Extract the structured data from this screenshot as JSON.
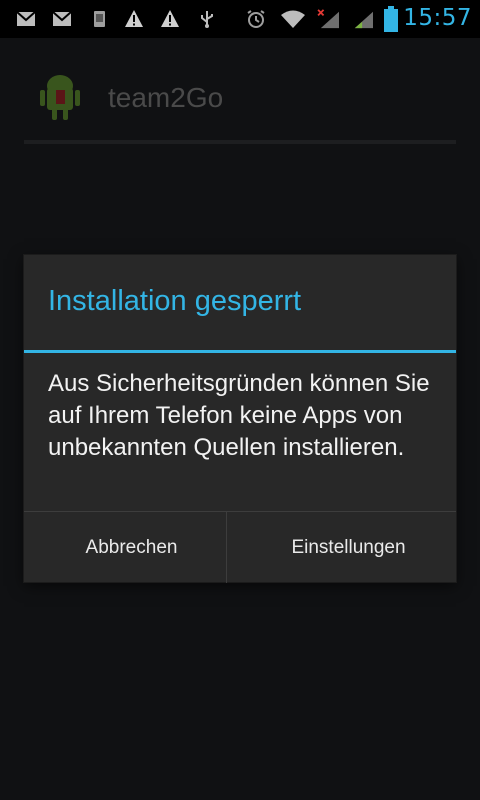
{
  "status_bar": {
    "time": "15:57",
    "accent_color": "#33b5e5",
    "icons": [
      "gmail-icon",
      "gmail-icon",
      "phone-storage-icon",
      "warning-icon",
      "warning-icon",
      "usb-icon",
      "alarm-icon",
      "wifi-icon",
      "signal-no-data-icon",
      "signal-icon",
      "battery-icon"
    ]
  },
  "app_header": {
    "title": "team2Go",
    "icon": "android-app-icon"
  },
  "dialog": {
    "title": "Installation gesperrt",
    "message": "Aus Sicherheitsgründen können Sie auf Ihrem Telefon keine Apps von unbekannten Quellen installieren.",
    "buttons": {
      "cancel": "Abbrechen",
      "settings": "Einstellungen"
    }
  }
}
